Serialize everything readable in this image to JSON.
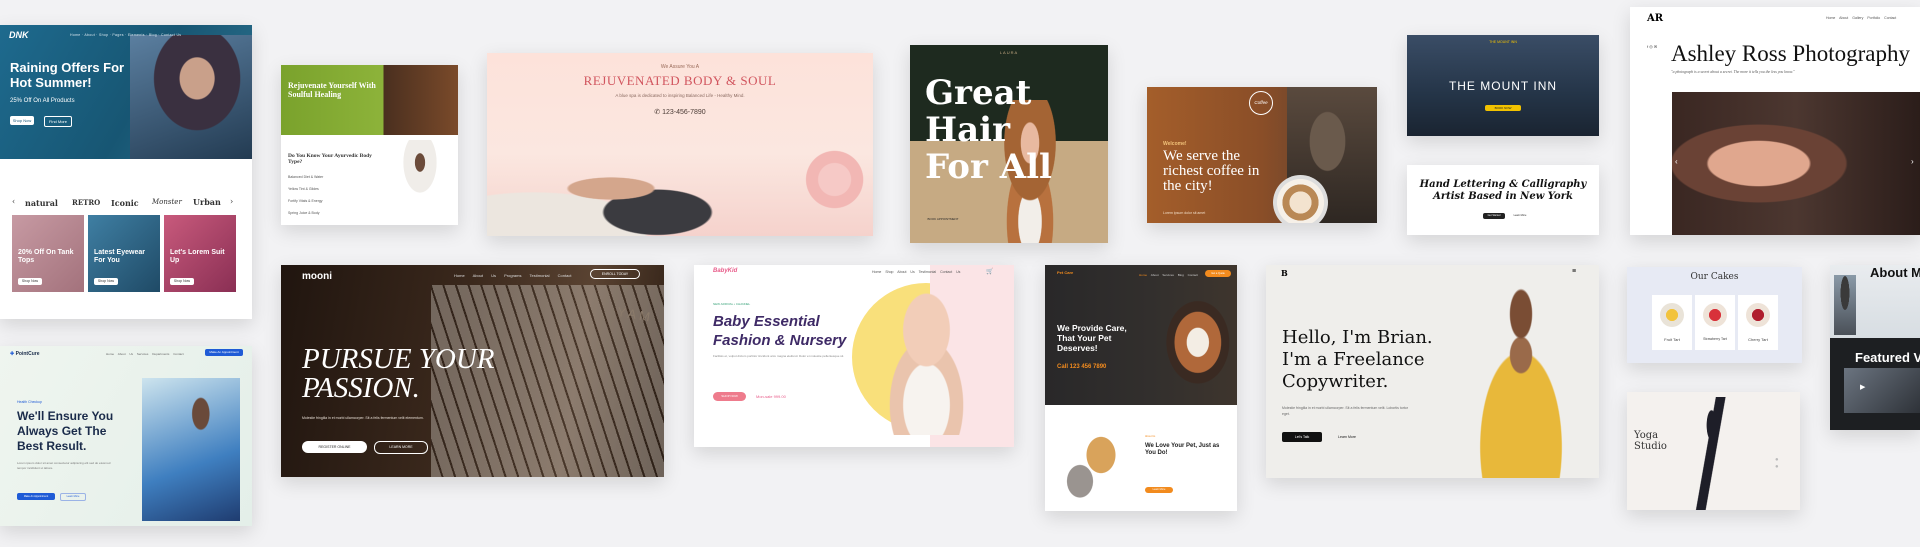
{
  "colors": {
    "background": "#f2f2f4",
    "dnk_blue": "#1c5b7d",
    "mooni_dark": "#2a1c14",
    "mount_blue": "#243447",
    "pet_orange": "#f28b1e",
    "medical_blue": "#1f5bd6"
  },
  "dnk": {
    "logo": "DNK",
    "nav": "Home · About · Shop · Pages · Elements · Blog · Contact Us",
    "heading": "Raining Offers For Hot Summer!",
    "sub": "25% Off On All Products",
    "btn1": "Shop Now",
    "btn2": "Find More",
    "brands": [
      "natural",
      "RETRO",
      "Iconic",
      "Monster",
      "Urban"
    ],
    "promos": [
      {
        "title": "20% Off On Tank Tops",
        "btn": "Shop Now"
      },
      {
        "title": "Latest Eyewear For You",
        "btn": "Shop Now"
      },
      {
        "title": "Let's Lorem Suit Up",
        "btn": "Shop Now"
      }
    ]
  },
  "ayur": {
    "heading": "Rejuvenate Yourself With Soulful Healing",
    "question": "Do You Know Your Ayurvedic Body Type?",
    "items": [
      "Balanced Diet & Water",
      "Yellow Tint & Glides",
      "Fortify Vitals & Energy",
      "Spring Juice & Body"
    ]
  },
  "spa": {
    "eyebrow": "We Assure You A",
    "title": "REJUVENATED BODY & SOUL",
    "tagline": "A blue spa is dedicated to inspiring Balanced Life - Healthy Mind.",
    "phone": "123-456-7890"
  },
  "hair": {
    "logo": "LAURA",
    "heading": "Great Hair For All",
    "btn": "BOOK APPOINTMENT"
  },
  "coffee": {
    "logo": "Coffee",
    "welcome": "Welcome!",
    "heading": "We serve the richest coffee in the city!",
    "sub": "Lorem ipsum dolor sit amet"
  },
  "mount": {
    "logo": "THE MOUNT INN",
    "heading": "THE MOUNT INN",
    "btn": "BOOK NOW"
  },
  "letter": {
    "heading": "Hand Lettering & Calligraphy Artist Based in New York",
    "btn1": "Get Started",
    "btn2": "Learn More"
  },
  "ashley": {
    "logo": "AR",
    "nav": [
      "Home",
      "About",
      "Gallery",
      "Portfolio",
      "Contact"
    ],
    "title": "Ashley Ross Photography",
    "caption": "\"a photograph is a secret about a secret. The more it tells you the less you know.\""
  },
  "medical": {
    "logo": "PointCure",
    "nav": [
      "Home",
      "About Us",
      "Services",
      "Departments",
      "Contact"
    ],
    "cta": "Make An Appointment",
    "eyebrow": "Health Checkup",
    "heading": "We'll Ensure You Always Get The Best Result.",
    "body": "Lorem ipsum dolor sit amet consectetur adipiscing elit sed do eiusmod tempor incididunt ut labore.",
    "btn1": "Make An Appointment",
    "btn2": "Learn More"
  },
  "mooni": {
    "logo": "mooni",
    "nav": [
      "Home",
      "About Us",
      "Programs",
      "Testimonial",
      "Contact"
    ],
    "enroll": "ENROLL TODAY",
    "heading": "PURSUE YOUR PASSION.",
    "body": "Molestie fringilla in et morbi ullamcorper. Sit a felis fermentum velit elementum.",
    "btn1": "REGISTER ONLINE",
    "btn2": "LEARN MORE",
    "brand": "YAM"
  },
  "baby": {
    "logo": "BabyKid",
    "nav": [
      "Home",
      "Shop",
      "About Us",
      "Testimonial",
      "Contact Us"
    ],
    "eyebrow": "NEW ARRIVAL • CHANNEL",
    "heading": "Baby Essential Fashion & Nursery",
    "body": "Facilisis et, vulput dictum porttitor tincidunt arcu magna eleifend. Dolor et molestie pellentesque sit.",
    "btn": "SHOP NOW",
    "call": "Mon-sale 999.00"
  },
  "pet": {
    "logo": "Pet Care",
    "nav": [
      "Home",
      "About",
      "Services",
      "Blog",
      "Contact"
    ],
    "cta": "Get a Quote",
    "heading": "We Provide Care, That Your Pet Deserves!",
    "phone": "Call 123 456 7890",
    "eyebrow": "About Us",
    "heading2": "We Love Your Pet, Just as You Do!",
    "btn": "Learn More"
  },
  "brian": {
    "logo": "B",
    "heading": "Hello, I'm Brian. I'm a Freelance Copywriter.",
    "body": "Molestie fringilla in et morbi ullamcorper. Sit a felis fermentum velit. Lobortis tortor eget.",
    "btn1": "Let's Talk",
    "btn2": "Learn More"
  },
  "cakes": {
    "heading": "Our Cakes",
    "items": [
      "Fruit Tart",
      "Strawberry Tart",
      "Cherry Tart"
    ]
  },
  "yoga": {
    "heading": "Yoga Studio"
  },
  "about": {
    "heading": "About M",
    "featured": "Featured Vi"
  }
}
